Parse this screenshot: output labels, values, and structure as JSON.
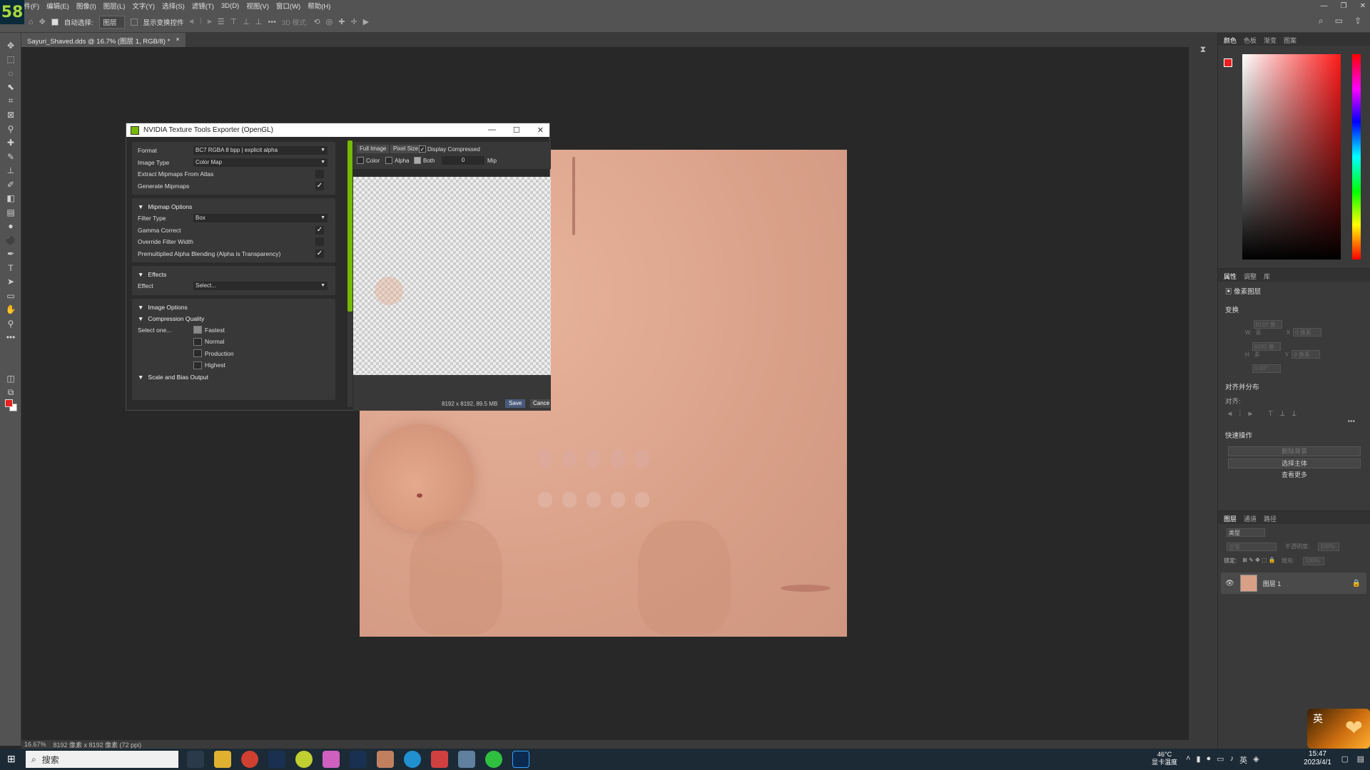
{
  "app": {
    "logo": "58"
  },
  "menu": [
    "文件(F)",
    "编辑(E)",
    "图像(I)",
    "图层(L)",
    "文字(Y)",
    "选择(S)",
    "滤镜(T)",
    "3D(D)",
    "视图(V)",
    "窗口(W)",
    "帮助(H)"
  ],
  "options": {
    "auto_select_label": "自动选择:",
    "auto_select_value": "图层",
    "show_transform_label": "显示变换控件",
    "mode_3d_label": "3D 模式:"
  },
  "document": {
    "tab_title": "Sayuri_Shaved.dds @ 16.7% (图层 1, RGB/8) *",
    "close": "×"
  },
  "status": {
    "zoom": "16.67%",
    "doc_info": "8192 像素 x 8192 像素 (72 ppi)"
  },
  "dialog": {
    "title": "NVIDIA Texture Tools Exporter (OpenGL)",
    "format_label": "Format",
    "format_value": "BC7      RGBA   8 bpp | explicit alpha",
    "image_type_label": "Image Type",
    "image_type_value": "Color Map",
    "extract_mipmaps_label": "Extract Mipmaps From Atlas",
    "generate_mipmaps_label": "Generate Mipmaps",
    "mipmap_options_label": "Mipmap Options",
    "filter_type_label": "Filter Type",
    "filter_type_value": "Box",
    "gamma_correct_label": "Gamma Correct",
    "override_filter_label": "Override Filter Width",
    "premult_label": "Premultiplied Alpha Blending (Alpha is Transparency)",
    "effects_label": "Effects",
    "effect_label": "Effect",
    "effect_value": "Select...",
    "image_options_label": "Image Options",
    "compression_quality_label": "Compression Quality",
    "select_one_label": "Select one...",
    "quality_options": [
      "Fastest",
      "Normal",
      "Production",
      "Highest"
    ],
    "quality_selected": "Fastest",
    "scale_bias_label": "Scale and Bias Output",
    "check": "✓",
    "full_image_btn": "Full Image",
    "pixel_size_btn": "Pixel Size",
    "display_compressed_label": "Display Compressed",
    "color_label": "Color",
    "alpha_label": "Alpha",
    "both_label": "Both",
    "mip_value": "0",
    "mip_label": "Mip",
    "image_info": "8192 x 8192, 89.5 MB",
    "save_btn": "Save",
    "cancel_btn": "Cance"
  },
  "panels": {
    "color_tabs": [
      "颜色",
      "色板",
      "渐变",
      "图案"
    ],
    "props_tabs": [
      "属性",
      "调整",
      "库"
    ],
    "pixel_layer": "像素图层",
    "transform": "变换",
    "w_label": "W",
    "h_label": "H",
    "x_label": "X",
    "y_label": "Y",
    "w_value": "8192 像素",
    "h_value": "8192 像素",
    "x_value": "0 像素",
    "y_value": "0 像素",
    "angle_value": "0.00°",
    "align_section": "对齐并分布",
    "align_label": "对齐:",
    "quick_actions": "快速操作",
    "remove_bg": "删除背景",
    "select_subject": "选择主体",
    "view_more": "查看更多",
    "layers_tabs": [
      "图层",
      "通道",
      "路径"
    ],
    "kind_label": "类型",
    "blend_mode": "正常",
    "opacity_label": "不透明度:",
    "opacity_value": "100%",
    "lock_label": "锁定:",
    "fill_label": "填充:",
    "fill_value": "100%",
    "layer_name": "图层 1"
  },
  "taskbar": {
    "search": "搜索",
    "weather_temp": "46°C",
    "weather_desc": "显卡温度",
    "ime": "英",
    "time": "15:47",
    "date": "2023/4/1"
  }
}
